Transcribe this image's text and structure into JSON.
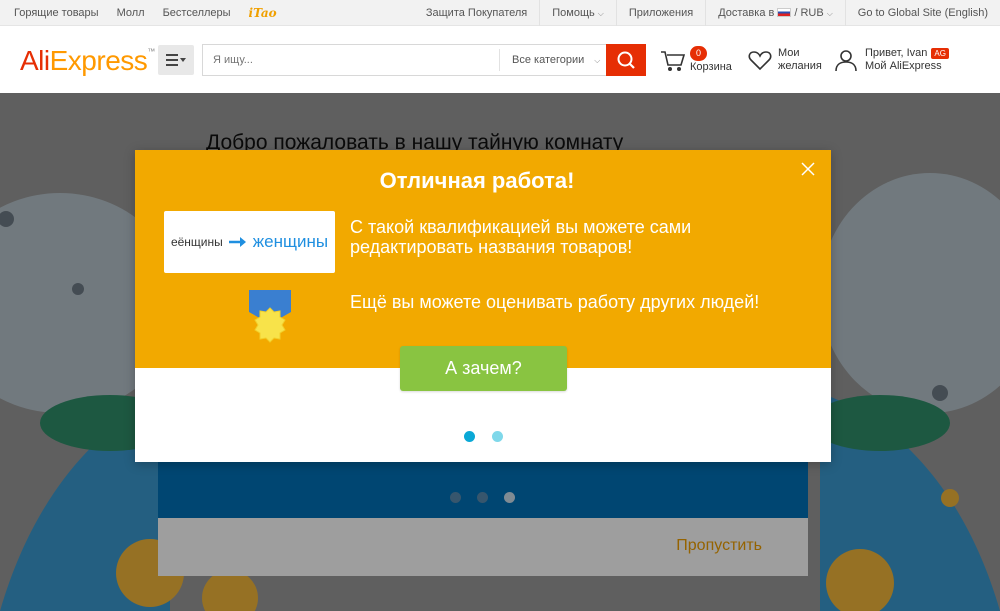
{
  "topbar": {
    "left": [
      "Горящие товары",
      "Молл",
      "Бестселлеры"
    ],
    "tao_logo": "iTao",
    "right": {
      "buyer_protection": "Защита Покупателя",
      "help": "Помощь",
      "apps": "Приложения",
      "delivery_prefix": "Доставка в",
      "currency": "/ RUB",
      "global_site": "Go to Global Site (English)"
    }
  },
  "header": {
    "logo_part1": "Ali",
    "logo_part2": "Express",
    "logo_tm": "™",
    "search_placeholder": "Я ищу...",
    "search_category": "Все категории",
    "cart_count": "0",
    "cart_label": "Корзина",
    "wish_line1": "Мои",
    "wish_line2": "желания",
    "account_line1": "Привет, Ivan",
    "account_badge": "AG",
    "account_line2": "Мой AliExpress"
  },
  "page": {
    "welcome": "Добро пожаловать в нашу тайную комнату",
    "skip": "Пропустить"
  },
  "modal": {
    "title": "Отличная работа!",
    "example_old": "еёнщины",
    "example_new": "женщины",
    "text1": "С такой квалификацией вы можете сами редактировать названия товаров!",
    "text2": "Ещё вы можете оценивать работу других людей!",
    "button": "А зачем?"
  },
  "colors": {
    "brand_red": "#e62e04",
    "modal_orange": "#f2a900",
    "button_green": "#89c441",
    "dot_active": "#0aa8d6",
    "band_blue": "#0071b8"
  }
}
